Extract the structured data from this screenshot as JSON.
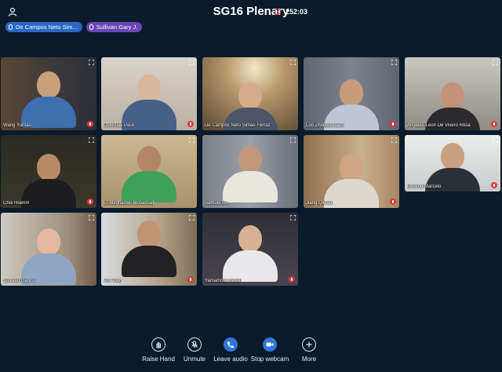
{
  "meeting": {
    "title": "SG16 Plenary",
    "timer": "252:03"
  },
  "presenters": [
    {
      "name": "De Campos Neto Sim...",
      "color": "#2b67c4"
    },
    {
      "name": "Sullivan Gary J.",
      "color": "#6a46b8"
    }
  ],
  "participants": [
    {
      "name": "Wang Yuntao",
      "muted": true
    },
    {
      "name": "Overdale Paul",
      "muted": true
    },
    {
      "name": "De Campos Neto Simao Ferraz",
      "muted": false
    },
    {
      "name": "Luo Zhong (Noah)",
      "muted": true
    },
    {
      "name": "Angeles-Leon De Vivero Rosa",
      "muted": true
    },
    {
      "name": "Choi Hoerim",
      "muted": true
    },
    {
      "name": "El-Megharbel Mohamad",
      "muted": false
    },
    {
      "name": "Samuel Bi...",
      "muted": false
    },
    {
      "name": "Jiang Qichen",
      "muted": true
    },
    {
      "name": "Moreno Marcelo",
      "muted": true
    },
    {
      "name": "Sullivan Gary J.",
      "muted": false
    },
    {
      "name": "Wu Tong",
      "muted": true
    },
    {
      "name": "Yamamoto Hideki",
      "muted": true
    }
  ],
  "controls": {
    "raise_hand": "Raise Hand",
    "unmute": "Unmute",
    "leave_audio": "Leave audio",
    "stop_webcam": "Stop webcam",
    "more": "More"
  },
  "colors": {
    "background": "#0b1b2b",
    "accent": "#2f78d8",
    "mute": "#d83b3b",
    "recording": "#e0464d"
  }
}
